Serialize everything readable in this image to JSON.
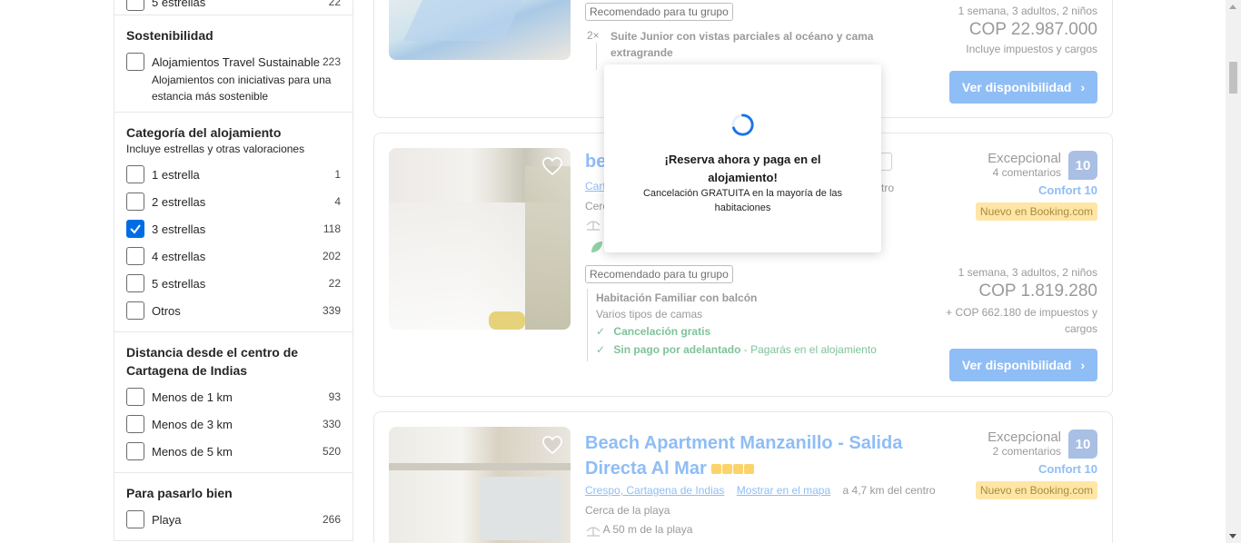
{
  "filters": {
    "top_partial": {
      "label": "5 estrellas",
      "count": "22"
    },
    "sustainability": {
      "title": "Sostenibilidad",
      "items": [
        {
          "label": "Alojamientos Travel Sustainable",
          "count": "223",
          "desc": "Alojamientos con iniciativas para una estancia más sostenible",
          "checked": false
        }
      ]
    },
    "category": {
      "title": "Categoría del alojamiento",
      "subtitle": "Incluye estrellas y otras valoraciones",
      "items": [
        {
          "label": "1 estrella",
          "count": "1",
          "checked": false
        },
        {
          "label": "2 estrellas",
          "count": "4",
          "checked": false
        },
        {
          "label": "3 estrellas",
          "count": "118",
          "checked": true
        },
        {
          "label": "4 estrellas",
          "count": "202",
          "checked": false
        },
        {
          "label": "5 estrellas",
          "count": "22",
          "checked": false
        },
        {
          "label": "Otros",
          "count": "339",
          "checked": false
        }
      ]
    },
    "distance": {
      "title": "Distancia desde el centro de Cartagena de Indias",
      "items": [
        {
          "label": "Menos de 1 km",
          "count": "93",
          "checked": false
        },
        {
          "label": "Menos de 3 km",
          "count": "330",
          "checked": false
        },
        {
          "label": "Menos de 5 km",
          "count": "520",
          "checked": false
        }
      ]
    },
    "fun": {
      "title": "Para pasarlo bien",
      "items": [
        {
          "label": "Playa",
          "count": "266",
          "checked": false
        }
      ]
    }
  },
  "results": [
    {
      "recommended": "Recomendado para tu grupo",
      "room_qty": "2×",
      "room_name": "Suite Junior con vistas parciales al océano y cama extragrande",
      "stay": "1 semana, 3 adultos, 2 niños",
      "price": "COP 22.987.000",
      "taxes": "Incluye impuestos y cargos",
      "cta": "Ver disponibilidad"
    },
    {
      "title_fragment": "be",
      "location_fragment": "Cart",
      "near_fragment": "Cerc",
      "distance_fragment": "tro",
      "review_word": "Excepcional",
      "review_count": "4 comentarios",
      "score": "10",
      "comfort": "Confort 10",
      "new_badge": "Nuevo en Booking.com",
      "recommended": "Recomendado para tu grupo",
      "room_name": "Habitación Familiar con balcón",
      "beds": "Varios tipos de camas",
      "perk1": "Cancelación gratis",
      "perk2_bold": "Sin pago por adelantado",
      "perk2_rest": " - Pagarás en el alojamiento",
      "stay": "1 semana, 3 adultos, 2 niños",
      "price": "COP 1.819.280",
      "taxes": "+ COP 662.180 de impuestos y cargos",
      "cta": "Ver disponibilidad"
    },
    {
      "title": "Beach Apartment Manzanillo - Salida Directa Al Mar",
      "location": "Crespo, Cartagena de Indias",
      "map_link": "Mostrar en el mapa",
      "distance": "a 4,7 km del centro",
      "near": "Cerca de la playa",
      "beach": "A 50 m de la playa",
      "review_word": "Excepcional",
      "review_count": "2 comentarios",
      "score": "10",
      "comfort": "Confort 10",
      "new_badge": "Nuevo en Booking.com"
    }
  ],
  "modal": {
    "title": "¡Reserva ahora y paga en el alojamiento!",
    "text": "Cancelación GRATUITA en la mayoría de las habitaciones"
  }
}
